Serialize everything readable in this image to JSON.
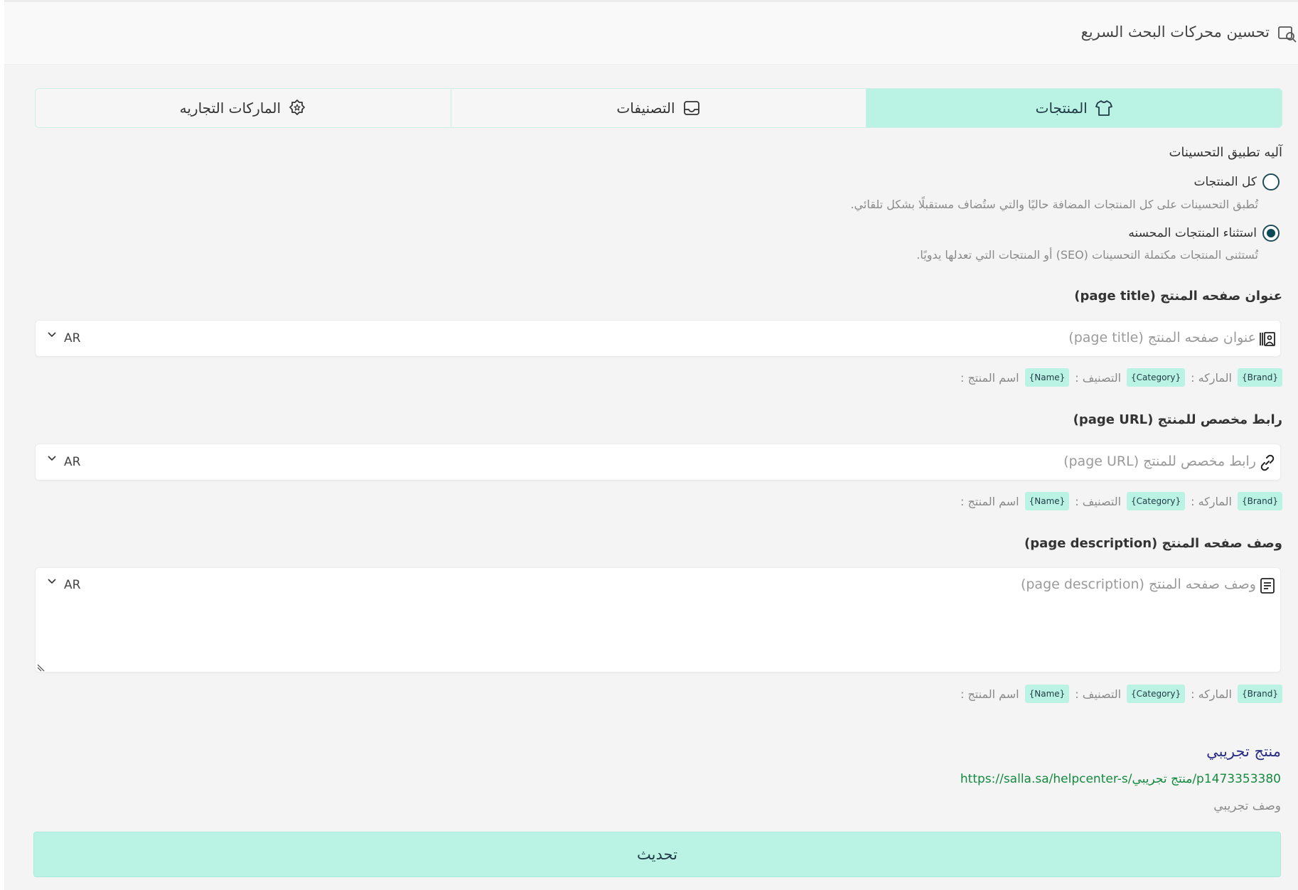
{
  "header": {
    "title": "تحسين محركات البحث السريع",
    "icon": "seo-search-icon"
  },
  "tabs": [
    {
      "label": "المنتجات",
      "icon": "shirt-icon",
      "active": true
    },
    {
      "label": "التصنيفات",
      "icon": "tray-icon",
      "active": false
    },
    {
      "label": "الماركات التجاريه",
      "icon": "badge-icon",
      "active": false
    }
  ],
  "mechanism": {
    "label": "آليه تطبيق التحسينات",
    "options": [
      {
        "label": "كل المنتجات",
        "help": "تُطبق التحسينات على كل المنتجات المضافة حاليًا والتي ستُضاف مستقبلًا بشكل تلقائي.",
        "checked": false
      },
      {
        "label": "استثناء المنتجات المحسنه",
        "help": "تُستثنى المنتجات مكتملة التحسينات (SEO) أو المنتجات التي تعدلها يدويًا.",
        "checked": true
      }
    ]
  },
  "fields": {
    "title": {
      "label": "عنوان صفحه المنتج (page title)",
      "placeholder": "عنوان صفحه المنتج (page title)",
      "lang": "AR",
      "icon": "title-icon"
    },
    "url": {
      "label": "رابط مخصص للمنتج (page URL)",
      "placeholder": "رابط مخصص للمنتج (page URL)",
      "lang": "AR",
      "icon": "link-icon"
    },
    "description": {
      "label": "وصف صفحه المنتج (page description)",
      "placeholder": "وصف صفحه المنتج (page description)",
      "lang": "AR",
      "icon": "document-icon"
    }
  },
  "variables": {
    "name_label": "اسم المنتج :",
    "name_chip": "{Name}",
    "category_label": "التصنيف :",
    "category_chip": "{Category}",
    "brand_label": "الماركه :",
    "brand_chip": "{Brand}"
  },
  "preview": {
    "title": "منتج تجريبي",
    "url": "https://salla.sa/helpcenter-s/منتج تجريبي/p1473353380",
    "description": "وصف تجريبي"
  },
  "actions": {
    "update_label": "تحديث"
  },
  "colors": {
    "accent": "#baf3e4",
    "accent_text": "#1f3a45",
    "preview_title": "#2b2f86",
    "preview_url": "#138a3e"
  }
}
